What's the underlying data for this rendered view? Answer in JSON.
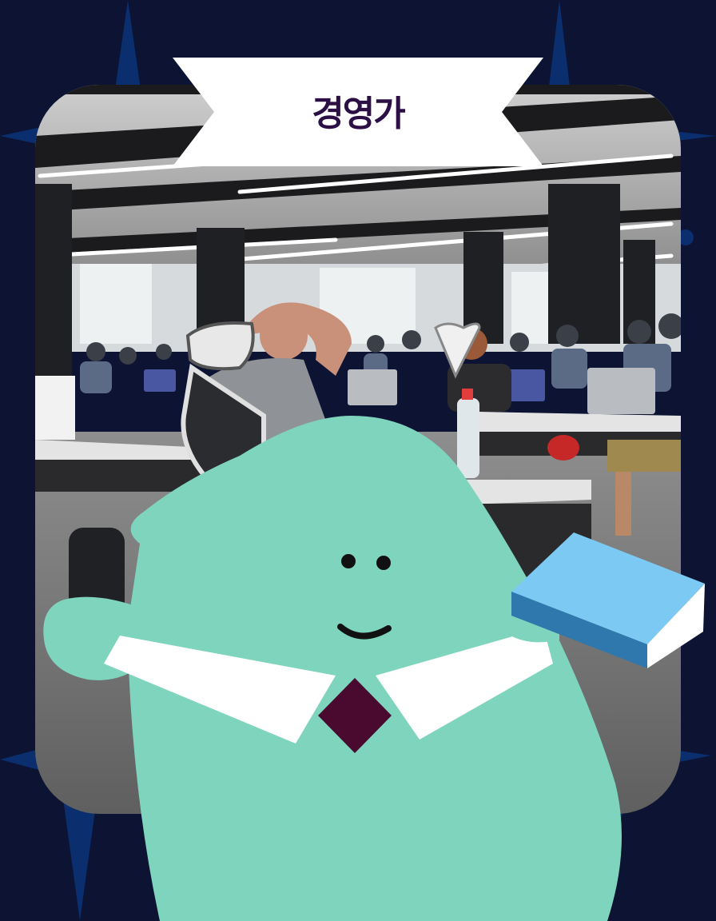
{
  "card": {
    "title": "경영가",
    "colors": {
      "background": "#0c1333",
      "star": "#0a2e6e",
      "character_body": "#7fd4bd",
      "collar": "#ffffff",
      "tie": "#4a0a30",
      "book_top": "#7ccaf3",
      "book_side": "#2f78ad",
      "banner": "#ffffff",
      "title_text": "#2b0f45"
    },
    "icons": [
      "sparkle-star-decoration",
      "office-photo",
      "character-mascot",
      "book-icon"
    ]
  }
}
